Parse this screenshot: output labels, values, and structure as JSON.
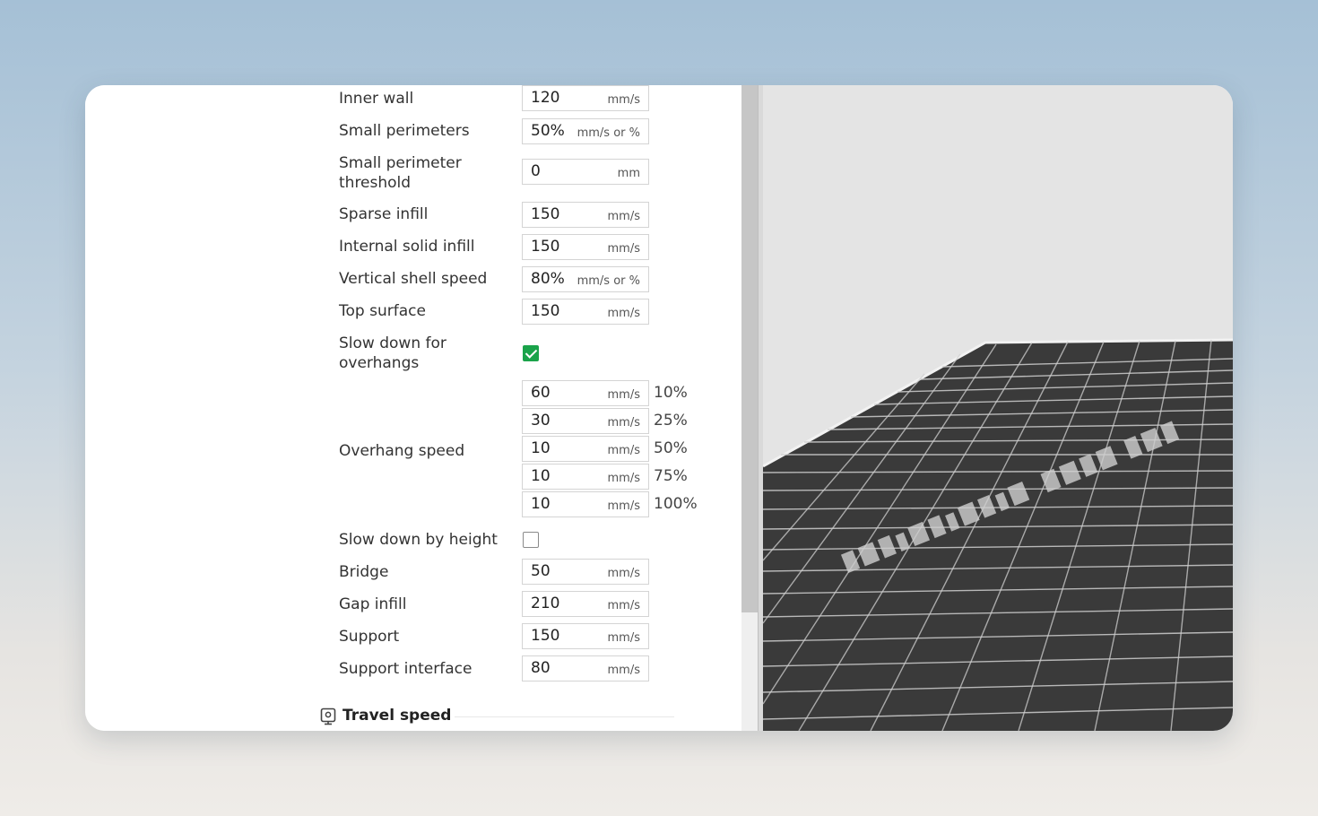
{
  "speed_rows": [
    {
      "label": "Inner wall",
      "value": "120",
      "unit": "mm/s"
    },
    {
      "label": "Small perimeters",
      "value": "50%",
      "unit": "mm/s or %"
    },
    {
      "label": "Small perimeter threshold",
      "value": "0",
      "unit": "mm"
    },
    {
      "label": "Sparse infill",
      "value": "150",
      "unit": "mm/s"
    },
    {
      "label": "Internal solid infill",
      "value": "150",
      "unit": "mm/s"
    },
    {
      "label": "Vertical shell speed",
      "value": "80%",
      "unit": "mm/s or %"
    },
    {
      "label": "Top surface",
      "value": "150",
      "unit": "mm/s"
    }
  ],
  "slow_overhangs": {
    "label": "Slow down for overhangs",
    "checked": true
  },
  "overhang_speed": {
    "label": "Overhang speed",
    "entries": [
      {
        "value": "60",
        "unit": "mm/s",
        "percent": "10%"
      },
      {
        "value": "30",
        "unit": "mm/s",
        "percent": "25%"
      },
      {
        "value": "10",
        "unit": "mm/s",
        "percent": "50%"
      },
      {
        "value": "10",
        "unit": "mm/s",
        "percent": "75%"
      },
      {
        "value": "10",
        "unit": "mm/s",
        "percent": "100%"
      }
    ]
  },
  "slow_height": {
    "label": "Slow down by height",
    "checked": false
  },
  "lower_rows": [
    {
      "label": "Bridge",
      "value": "50",
      "unit": "mm/s"
    },
    {
      "label": "Gap infill",
      "value": "210",
      "unit": "mm/s"
    },
    {
      "label": "Support",
      "value": "150",
      "unit": "mm/s"
    },
    {
      "label": "Support interface",
      "value": "80",
      "unit": "mm/s"
    }
  ],
  "travel_section": {
    "title": "Travel speed",
    "icon": "travel-speed-icon"
  },
  "colors": {
    "accent": "#1aa34a",
    "plate": "#3a3a3a",
    "plate_grid": "#d0d0d0"
  }
}
